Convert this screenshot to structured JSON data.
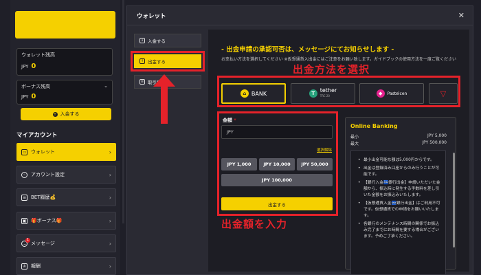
{
  "sidebar": {
    "wallet_label": "ウォレット残高",
    "wallet_currency": "JPY",
    "wallet_value": "0",
    "bonus_label": "ボーナス残高",
    "bonus_currency": "JPY",
    "bonus_value": "0",
    "deposit_label": "入金する",
    "my_account": "マイアカウント",
    "menu": [
      {
        "label": "ウォレット",
        "icon": "wallet-icon"
      },
      {
        "label": "アカウント設定",
        "icon": "account-icon"
      },
      {
        "label": "BET履歴💰",
        "icon": "bet-icon"
      },
      {
        "label": "🎁ボーナス🎁",
        "icon": "gift-icon"
      },
      {
        "label": "メッセージ",
        "icon": "message-icon",
        "badge": "1"
      },
      {
        "label": "報酬",
        "icon": "reward-icon"
      }
    ]
  },
  "modal": {
    "title": "ウォレット",
    "tabs": [
      {
        "label": "入金する"
      },
      {
        "label": "出金する"
      },
      {
        "label": "取引履歴"
      }
    ],
    "notice": "- 出金申請の承認可否は、メッセージにてお知らせします -",
    "desc": "お支払い方法を選択してください ※仮想通貨入出金にはご注意をお願い致します。ガイドブックの使用方法を一度ご覧ください",
    "label_method": "出金方法を選択",
    "label_amount": "出金額を入力",
    "methods": [
      {
        "name": "BANK",
        "icon": "bank-coin-icon"
      },
      {
        "name": "tether",
        "sub": "TRC 20",
        "icon": "tether-icon"
      },
      {
        "name": "Pastelcen",
        "icon": "pastel-icon"
      },
      {
        "name": "",
        "icon": "tron-icon"
      }
    ],
    "amount_label": "金額",
    "amount_required": "*",
    "amount_placeholder": "JPY",
    "select_cancel": "選択解除",
    "amount_buttons": [
      "JPY 1,000",
      "JPY 10,000",
      "JPY 50,000",
      "JPY 100,000"
    ],
    "withdraw_button": "出金する",
    "info": {
      "title": "Online Banking",
      "min_label": "最小",
      "min_value": "JPY 5,000",
      "max_label": "最大",
      "max_value": "JPY 500,000",
      "rules": [
        "最小出金可能な額は5,000円からです。",
        "出金は登録済み口座からのみ行うことが可能です。",
        "【銀行入金🏧銀行出金】申請いただいた金額から、振込時に発生する手数料を差し引いた金額をお振込みいたします。",
        "【仮想通貨入金🏧銀行出金】はご利用不可です。仮想通貨での申請をお願いいたします。",
        "各銀行のメンテナンス時間の関係でお振込み完了までにお時間を要する場合がございます。予めご了承ください。"
      ]
    }
  },
  "colors": {
    "accent": "#f5d000",
    "highlight": "#e5222a"
  }
}
